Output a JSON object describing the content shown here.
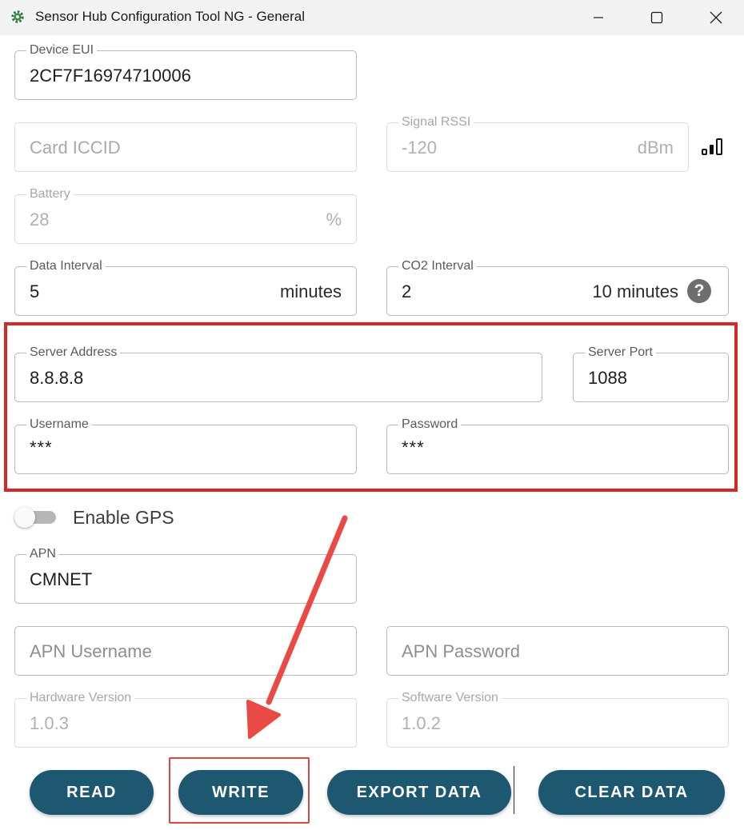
{
  "window": {
    "title": "Sensor Hub Configuration Tool NG - General",
    "app_icon": "gear-icon",
    "controls": [
      "minimize-icon",
      "maximize-icon",
      "close-icon"
    ]
  },
  "fields": {
    "device_eui": {
      "label": "Device EUI",
      "value": "2CF7F16974710006"
    },
    "card_iccid": {
      "placeholder": "Card ICCID"
    },
    "signal_rssi": {
      "label": "Signal RSSI",
      "value": "-120",
      "unit": "dBm",
      "icon": "signal-strength-icon"
    },
    "battery": {
      "label": "Battery",
      "value": "28",
      "unit": "%"
    },
    "data_interval": {
      "label": "Data Interval",
      "value": "5",
      "unit": "minutes"
    },
    "co2_interval": {
      "label": "CO2 Interval",
      "value": "2",
      "unit": "10 minutes",
      "help": "?"
    },
    "server_address": {
      "label": "Server Address",
      "value": "8.8.8.8"
    },
    "server_port": {
      "label": "Server Port",
      "value": "1088"
    },
    "username": {
      "label": "Username",
      "value": "***"
    },
    "password": {
      "label": "Password",
      "value": "***"
    },
    "apn": {
      "label": "APN",
      "value": "CMNET"
    },
    "apn_username": {
      "placeholder": "APN Username"
    },
    "apn_password": {
      "placeholder": "APN Password"
    },
    "hardware_version": {
      "label": "Hardware Version",
      "value": "1.0.3"
    },
    "software_version": {
      "label": "Software Version",
      "value": "1.0.2"
    }
  },
  "gps": {
    "label": "Enable GPS",
    "enabled": false
  },
  "actions": {
    "read": "READ",
    "write": "WRITE",
    "export": "EXPORT DATA",
    "clear": "CLEAR DATA"
  },
  "colors": {
    "button_bg": "#1d5870",
    "highlight": "#d42727",
    "arrow": "#e94a45"
  }
}
